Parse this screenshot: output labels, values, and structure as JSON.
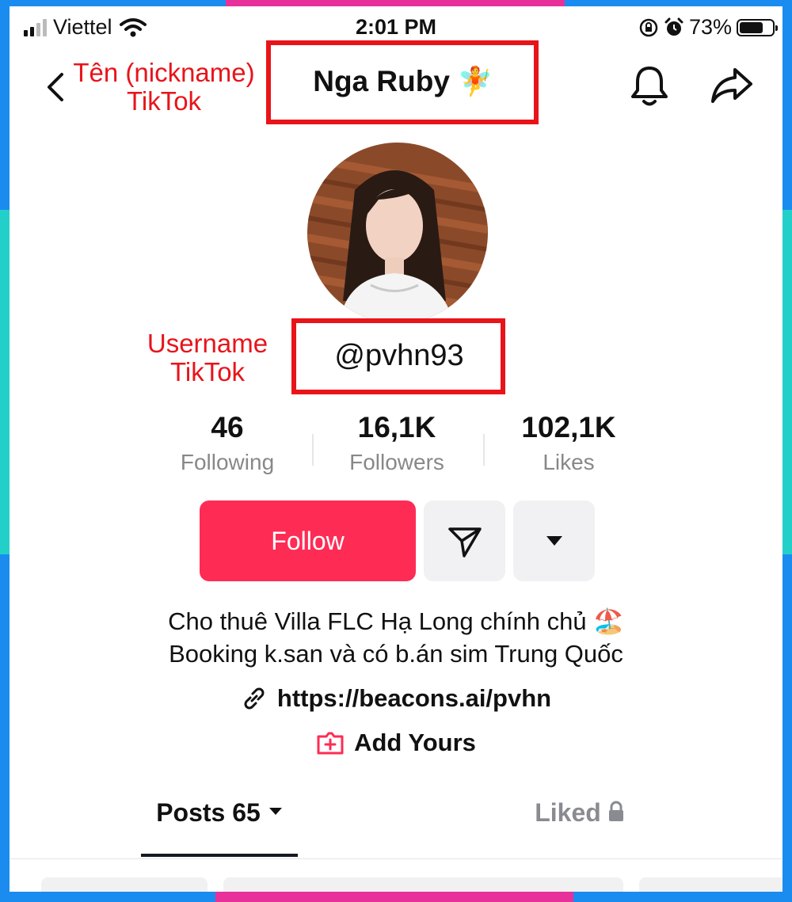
{
  "status_bar": {
    "carrier": "Viettel",
    "time": "2:01 PM",
    "battery": "73%",
    "battery_level": 0.73
  },
  "annotations": {
    "nickname_label_line1": "Tên (nickname)",
    "nickname_label_line2": "TikTok",
    "username_label_line1": "Username",
    "username_label_line2": "TikTok",
    "highlight_color": "#e8141a"
  },
  "profile": {
    "nickname": "Nga Ruby",
    "nickname_emoji": "🧚",
    "username": "@pvhn93"
  },
  "stats": [
    {
      "value": "46",
      "label": "Following"
    },
    {
      "value": "16,1K",
      "label": "Followers"
    },
    {
      "value": "102,1K",
      "label": "Likes"
    }
  ],
  "actions": {
    "follow_label": "Follow",
    "follow_color": "#fe2c55"
  },
  "bio": {
    "line1": "Cho thuê Villa FLC Hạ Long chính chủ",
    "line1_emoji": "🏖️",
    "line2": "Booking k.san và có b.án sim Trung Quốc",
    "link": "https://beacons.ai/pvhn",
    "add_yours": "Add Yours"
  },
  "tabs": {
    "posts": "Posts 65",
    "liked": "Liked"
  },
  "icons": [
    "signal-icon",
    "wifi-icon",
    "orientation-lock-icon",
    "alarm-icon",
    "battery-icon",
    "back-chevron-icon",
    "bell-icon",
    "share-icon",
    "send-icon",
    "caret-down-icon",
    "link-icon",
    "add-yours-icon",
    "lock-icon"
  ]
}
